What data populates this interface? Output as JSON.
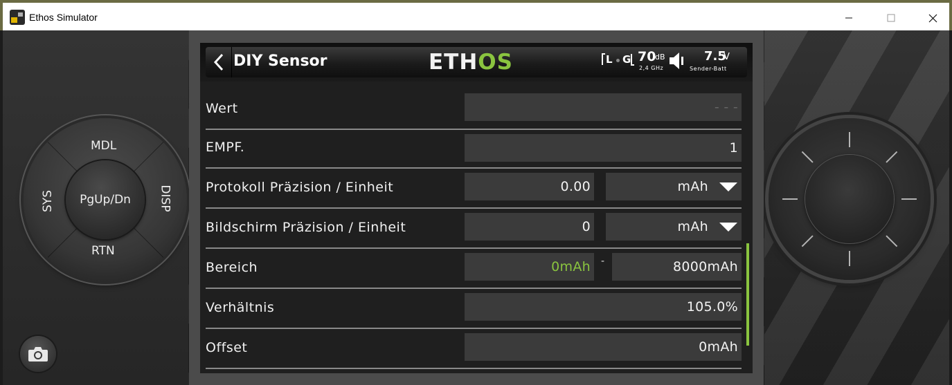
{
  "window": {
    "title": "Ethos Simulator",
    "minimize_icon": "minimize-icon",
    "maximize_icon": "maximize-icon",
    "close_icon": "close-icon"
  },
  "dpad": {
    "top": "MDL",
    "bottom": "RTN",
    "left": "SYS",
    "right": "DISP",
    "center": "PgUp/Dn"
  },
  "header": {
    "title": "DIY Sensor",
    "logo_part1": "ETH",
    "logo_part2": "OS",
    "status": {
      "l_label": "L",
      "g_label": "G",
      "rssi_value": "70",
      "rssi_unit": "dB",
      "band": "2,4 GHz",
      "voltage_value": "7.5",
      "voltage_unit": "V",
      "voltage_label": "Sender-Batt"
    }
  },
  "rows": [
    {
      "label": "Wert",
      "value": "- - -"
    },
    {
      "label": "EMPF.",
      "value": "1"
    },
    {
      "label": "Protokoll Präzision / Einheit",
      "value": "0.00",
      "unit": "mAh"
    },
    {
      "label": "Bildschirm Präzision / Einheit",
      "value": "0",
      "unit": "mAh"
    },
    {
      "label": "Bereich",
      "min": "0mAh",
      "separator": "-",
      "max": "8000mAh"
    },
    {
      "label": "Verhältnis",
      "value": "105.0%"
    },
    {
      "label": "Offset",
      "value": "0mAh"
    }
  ],
  "colors": {
    "accent": "#8ac43f",
    "field_bg": "#3b3b3b",
    "screen_bg": "#1f1f1f"
  }
}
